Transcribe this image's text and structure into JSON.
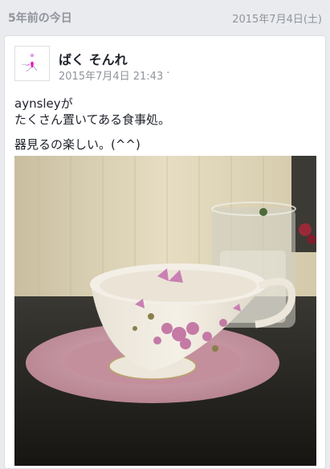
{
  "memories": {
    "title": "5年前の今日",
    "date": "2015年7月4日(土)"
  },
  "post": {
    "author": "ばく そんれ",
    "timestamp": "2015年7月4日 21:43",
    "separator": "·",
    "text_line1": "aynsleyが",
    "text_line2": "たくさん置いてある食事処。",
    "text_line3": "器見るの楽しい。(^^)"
  },
  "icons": {
    "avatar": "pink-figure-avatar-icon"
  },
  "colors": {
    "background": "#e9ebee",
    "secondary_text": "#90949c",
    "saucer": "#c99aa8",
    "wall": "#ddd3b5"
  }
}
